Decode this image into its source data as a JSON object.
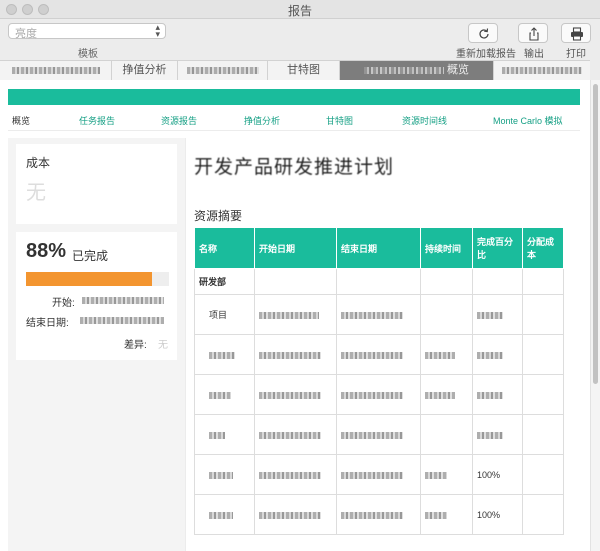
{
  "window": {
    "title": "报告"
  },
  "toolbar": {
    "select_value": "亮度",
    "select_caption": "模板",
    "reload_label": "重新加载报告",
    "export_label": "输出",
    "print_label": "打印",
    "icons": {
      "reload": "reload-icon",
      "export": "share-export-icon",
      "print": "printer-icon",
      "chevron": "chevron-updown-icon"
    }
  },
  "tabs": [
    {
      "label": "挣值分析"
    },
    {
      "label": "甘特图"
    },
    {
      "label": "概览"
    }
  ],
  "nav": {
    "items": [
      "概览",
      "任务报告",
      "资源报告",
      "挣值分析",
      "甘特图",
      "资源时间线",
      "Monte Carlo 模拟"
    ]
  },
  "cost_card": {
    "title": "成本",
    "value": "无"
  },
  "progress_card": {
    "percent_text": "88%",
    "percent_label": "已完成",
    "progress_fraction": 0.88,
    "start_label": "开始:",
    "end_label": "结束日期:",
    "variance_label": "差异:",
    "variance_value": "无"
  },
  "report": {
    "title": "开发产品研发推进计划",
    "section_title": "资源摘要",
    "columns": [
      "名称",
      "开始日期",
      "结束日期",
      "持续时间",
      "完成百分比",
      "分配成本"
    ],
    "group": "研发部",
    "rows": [
      {
        "name": "项目",
        "pct": ""
      },
      {
        "name": "",
        "pct": ""
      },
      {
        "name": "",
        "pct": ""
      },
      {
        "name": "",
        "pct": ""
      },
      {
        "name": "",
        "pct": "100%"
      },
      {
        "name": "",
        "pct": "100%"
      }
    ]
  },
  "colors": {
    "accent": "#1abc9c",
    "progress": "#f39530"
  }
}
